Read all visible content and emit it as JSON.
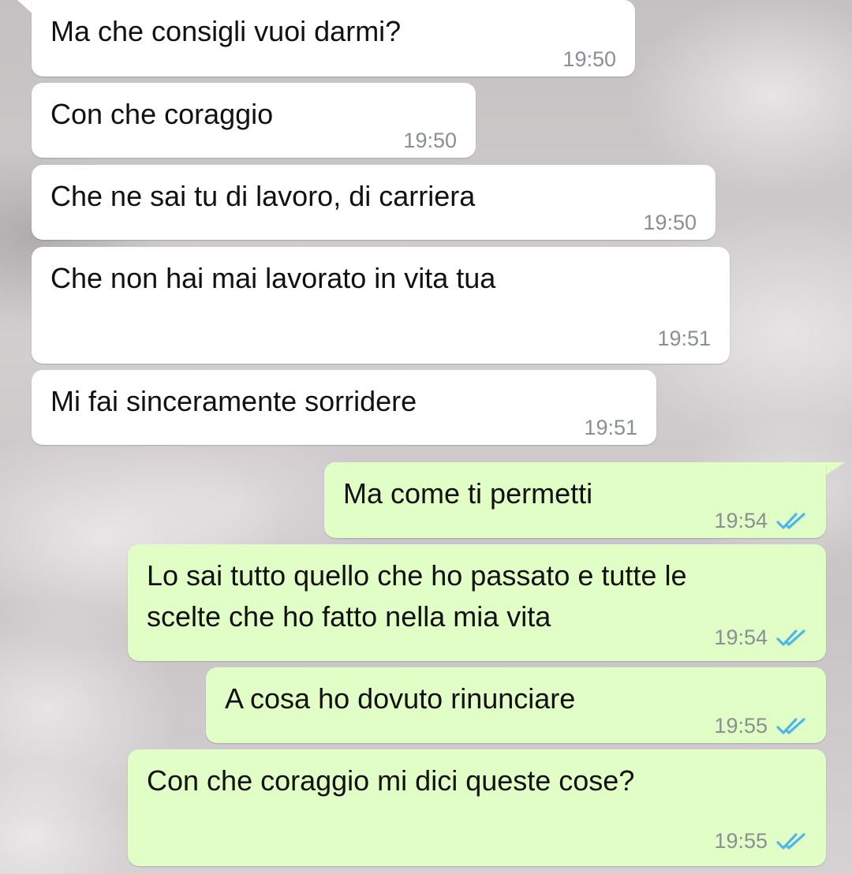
{
  "messages": [
    {
      "direction": "in",
      "text": "Ma che consigli vuoi darmi?",
      "time": "19:50"
    },
    {
      "direction": "in",
      "text": "Con che coraggio",
      "time": "19:50"
    },
    {
      "direction": "in",
      "text": "Che ne sai tu di lavoro, di carriera",
      "time": "19:50"
    },
    {
      "direction": "in",
      "text": "Che non hai mai lavorato in vita tua",
      "time": "19:51"
    },
    {
      "direction": "in",
      "text": "Mi fai sinceramente sorridere",
      "time": "19:51"
    },
    {
      "direction": "out",
      "text": "Ma come ti permetti",
      "time": "19:54",
      "status": "read"
    },
    {
      "direction": "out",
      "text": "Lo sai tutto quello che ho passato e tutte le\nscelte che ho fatto nella mia vita",
      "time": "19:54",
      "status": "read"
    },
    {
      "direction": "out",
      "text": "A cosa ho dovuto rinunciare",
      "time": "19:55",
      "status": "read"
    },
    {
      "direction": "out",
      "text": "Con che coraggio mi dici queste cose?",
      "time": "19:55",
      "status": "read"
    }
  ],
  "colors": {
    "incoming_bubble": "#ffffff",
    "outgoing_bubble": "#e1fec6",
    "timestamp": "#8a8f94",
    "read_check": "#4fb6ec"
  },
  "icons": {
    "read_receipt": "double-check-icon"
  }
}
